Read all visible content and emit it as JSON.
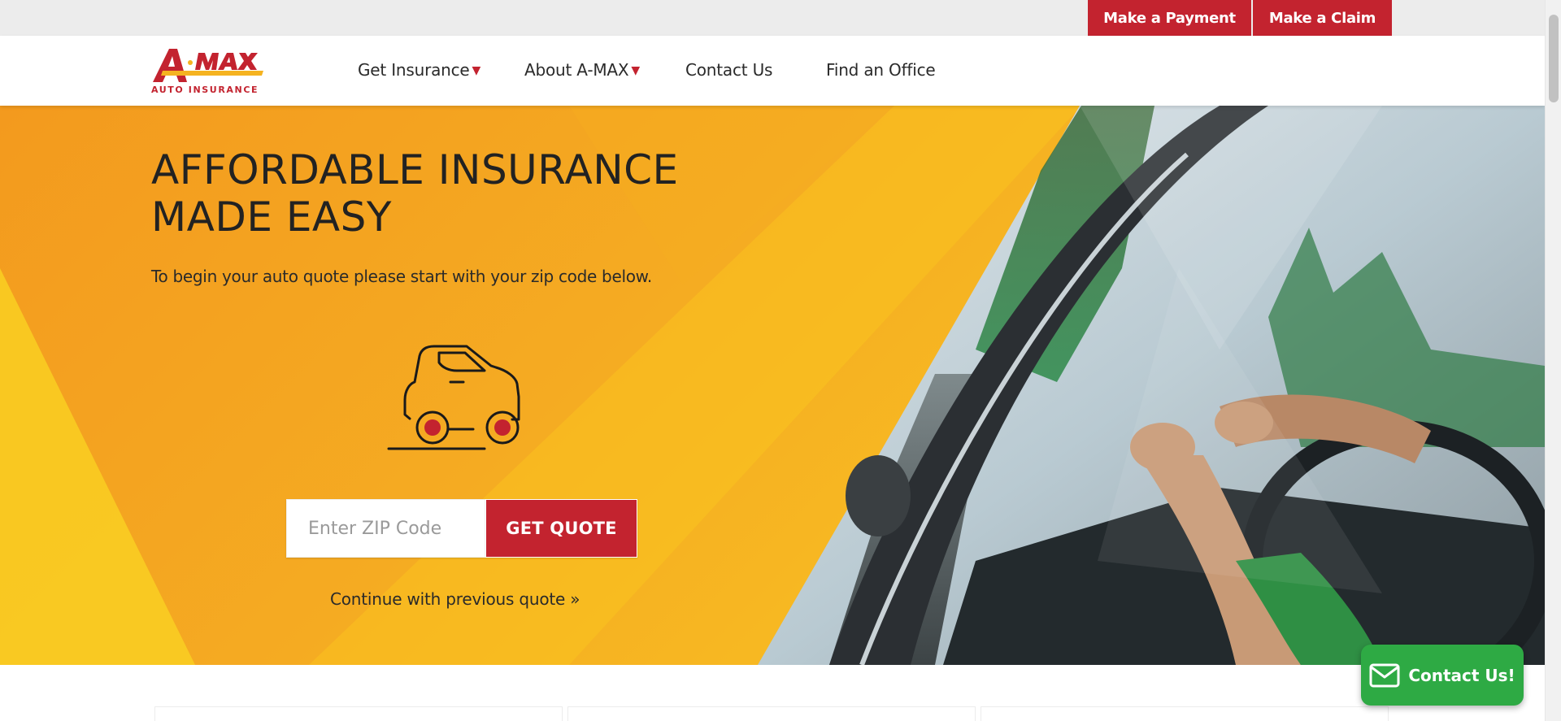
{
  "utility_bar": {
    "payment_label": "Make a Payment",
    "claim_label": "Make a Claim"
  },
  "header": {
    "logo_text": "A·MAX",
    "logo_subtext": "AUTO INSURANCE",
    "nav": [
      {
        "label": "Get Insurance",
        "has_dropdown": true
      },
      {
        "label": "About A-MAX",
        "has_dropdown": true
      },
      {
        "label": "Contact Us",
        "has_dropdown": false
      },
      {
        "label": "Find an Office",
        "has_dropdown": false
      }
    ],
    "dropdown_glyph": "▼"
  },
  "hero": {
    "title_line1": "AFFORDABLE INSURANCE",
    "title_line2": "MADE EASY",
    "subtitle": "To begin your auto quote please start with your zip code below.",
    "zip_placeholder": "Enter ZIP Code",
    "zip_value": "",
    "quote_button": "GET QUOTE",
    "continue_link": "Continue with previous quote »"
  },
  "contact_float": {
    "label": "Contact Us!",
    "icon": "envelope-icon"
  },
  "icons": {
    "car": "car-icon",
    "dropdown": "caret-down-icon",
    "mail": "envelope-icon"
  },
  "colors": {
    "brand_red": "#c3232f",
    "hero_orange": "#f5ab22",
    "hero_yellow": "#fac820",
    "contact_green": "#2eaa44",
    "utility_bg": "#ececec"
  }
}
